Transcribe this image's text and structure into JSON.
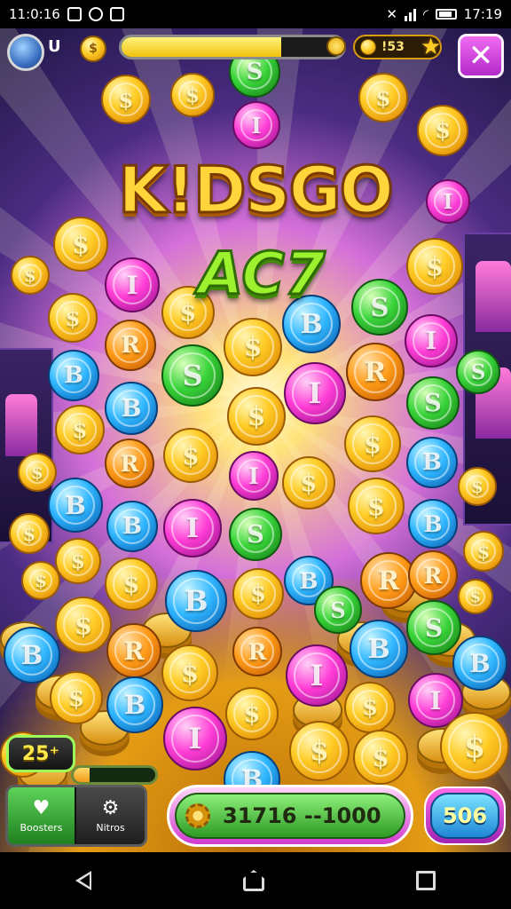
{
  "status_bar": {
    "time_left": "11:0:16",
    "time_right": "17:19"
  },
  "hud": {
    "level": "U",
    "coin_icon_symbol": "$",
    "progress_fraction": 0.72,
    "coins": "!53",
    "close_symbol": "✕"
  },
  "logo": {
    "line1": "K!DSGO",
    "line2": "AC7"
  },
  "coin_labels": {
    "gold": "$",
    "pink": "I",
    "green": "S",
    "blue": "B",
    "orange": "R"
  },
  "bottom": {
    "score": "25⁺",
    "mini_bar_fraction": 0.2,
    "left_button_label": "Boosters",
    "right_button_label": "Nitros",
    "center_text": "31716 --1000",
    "right_value": "506"
  },
  "colors": {
    "gold": "#ffcc25",
    "pink": "#ff3dd6",
    "green": "#39d43a",
    "blue": "#2fb6ff",
    "orange": "#ff9b18",
    "close": "#d13ddb"
  }
}
